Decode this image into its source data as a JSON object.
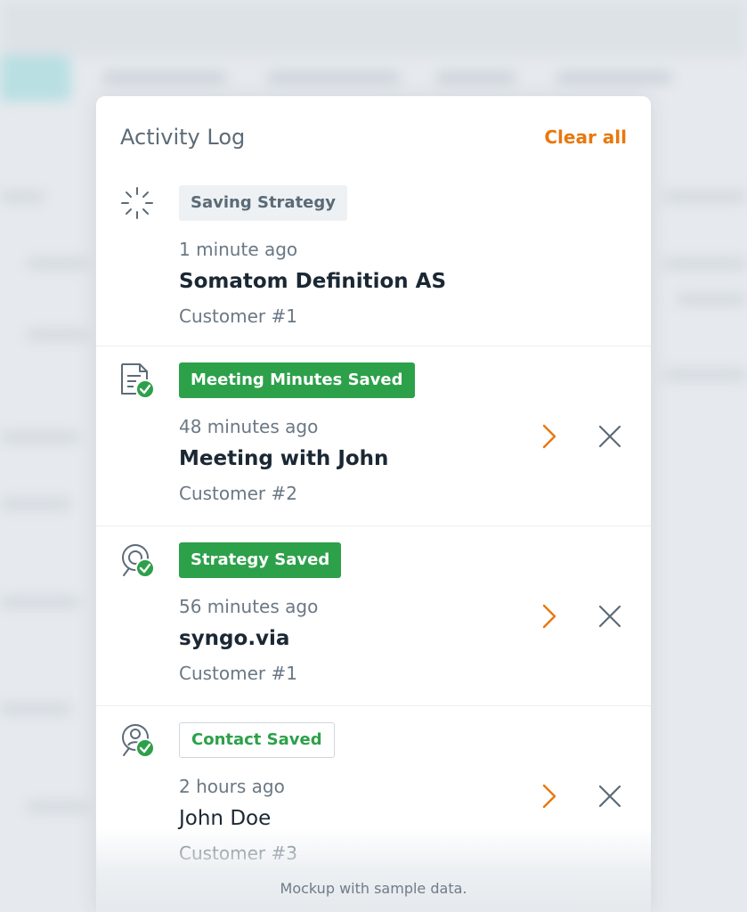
{
  "panel": {
    "title": "Activity Log",
    "clear_all_label": "Clear all"
  },
  "items": [
    {
      "icon": "loading-spinner-icon",
      "badge": "Saving Strategy",
      "badge_style": "neutral",
      "time": "1 minute ago",
      "name": "Somatom Definition AS",
      "customer": "Customer #1",
      "actions": false
    },
    {
      "icon": "document-check-icon",
      "badge": "Meeting Minutes Saved",
      "badge_style": "solid",
      "time": "48 minutes ago",
      "name": "Meeting with John",
      "customer": "Customer #2",
      "actions": true
    },
    {
      "icon": "strategy-check-icon",
      "badge": "Strategy Saved",
      "badge_style": "solid",
      "time": "56 minutes ago",
      "name": "syngo.via",
      "customer": "Customer #1",
      "actions": true
    },
    {
      "icon": "contact-check-icon",
      "badge": "Contact Saved",
      "badge_style": "outline",
      "time": "2 hours ago",
      "name": "John Doe",
      "customer": "Customer #3",
      "actions": true
    }
  ],
  "footnote": "Mockup with sample data.",
  "colors": {
    "accent": "#e8780e",
    "success": "#2da04a",
    "text_dark": "#1b2834",
    "text_muted": "#6a7884"
  }
}
